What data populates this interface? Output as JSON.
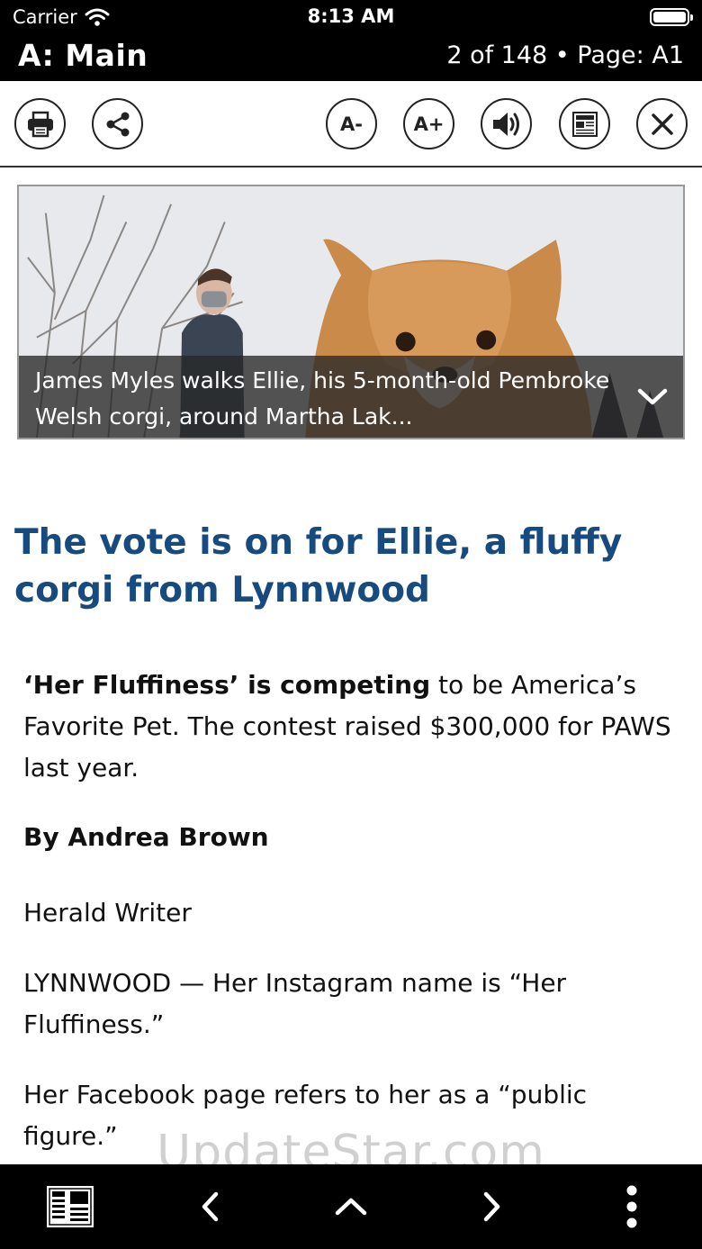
{
  "status": {
    "carrier": "Carrier",
    "time": "8:13 AM"
  },
  "header": {
    "section": "A: Main",
    "page_info": "2 of 148 • Page: A1"
  },
  "toolbar": {
    "font_smaller_label": "A-",
    "font_larger_label": "A+"
  },
  "photo": {
    "caption": "James Myles walks Ellie, his 5-month-old Pembroke Welsh corgi, around Martha Lak..."
  },
  "article": {
    "headline": "The vote is on for Ellie, a fluffy corgi from Lynnwood",
    "deck_bold": "‘Her Fluffiness’ is competing",
    "deck_rest": " to be America’s Favorite Pet. The contest raised $300,000 for PAWS last year.",
    "byline": "By Andrea Brown",
    "paragraphs": [
      "Herald Writer",
      "LYNNWOOD — Her Instagram name is “Her Fluffiness.”",
      "Her Facebook page refers to her as a “public figure.”"
    ]
  },
  "watermark": "UpdateStar.com",
  "icons": {
    "toolbar": [
      "print-icon",
      "share-icon",
      "decrease-font-icon",
      "increase-font-icon",
      "speaker-icon",
      "newspaper-icon",
      "close-icon"
    ],
    "bottom": [
      "newspaper-pages-icon",
      "chevron-left-icon",
      "chevron-up-icon",
      "chevron-right-icon",
      "more-vertical-icon"
    ]
  },
  "colors": {
    "headline": "#174a7e",
    "bars": "#000000"
  }
}
